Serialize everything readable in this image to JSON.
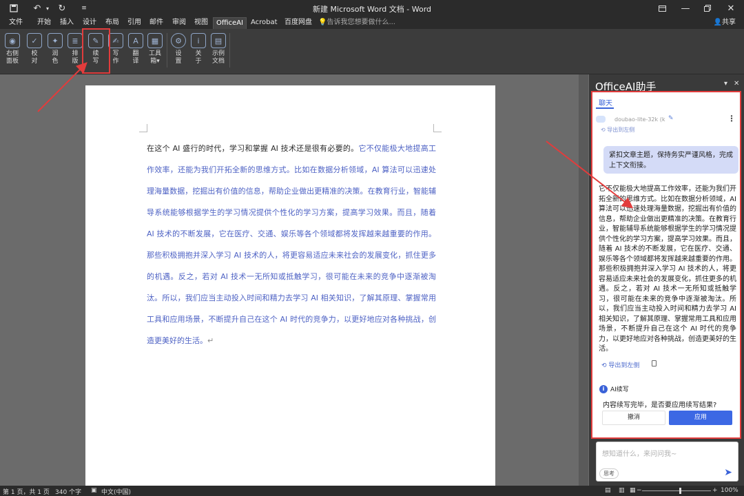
{
  "titlebar": {
    "title": "新建 Microsoft Word 文档 - Word",
    "quick_access": [
      "save-icon",
      "undo-icon",
      "redo-icon"
    ],
    "window_controls": [
      "ribbon-display-icon",
      "minimize-icon",
      "restore-icon",
      "close-icon"
    ]
  },
  "tabs": [
    "文件",
    "开始",
    "插入",
    "设计",
    "布局",
    "引用",
    "邮件",
    "审阅",
    "视图",
    "OfficeAI",
    "Acrobat",
    "百度网盘"
  ],
  "active_tab": "OfficeAI",
  "tell_me": "告诉我您想要做什么...",
  "share": "共享",
  "ribbon": {
    "buttons": [
      {
        "label": "右侧\n面板",
        "icon": "robot-icon"
      },
      {
        "label": "校\n对",
        "icon": "proofread-icon"
      },
      {
        "label": "润\n色",
        "icon": "polish-icon"
      },
      {
        "label": "排\n版",
        "icon": "format-icon"
      },
      {
        "label": "续\n写",
        "icon": "continue-write-icon"
      },
      {
        "label": "写\n作",
        "icon": "write-icon"
      },
      {
        "label": "翻\n译",
        "icon": "translate-icon"
      },
      {
        "label": "工具\n箱▾",
        "icon": "toolbox-icon"
      },
      {
        "label": "设\n置",
        "icon": "settings-icon"
      },
      {
        "label": "关\n于",
        "icon": "about-icon"
      },
      {
        "label": "示例\n文档",
        "icon": "sample-doc-icon"
      }
    ]
  },
  "document": {
    "text_plain": "在这个 AI 盛行的时代，学习和掌握 AI 技术还是很有必要的。",
    "text_ai": "它不仅能极大地提高工作效率，还能为我们开拓全新的思维方式。比如在数据分析领域，AI 算法可以迅速处理海量数据，挖掘出有价值的信息，帮助企业做出更精准的决策。在教育行业，智能辅导系统能够根据学生的学习情况提供个性化的学习方案，提高学习效果。而且，随着 AI 技术的不断发展，它在医疗、交通、娱乐等各个领域都将发挥越来越重要的作用。那些积极拥抱并深入学习 AI 技术的人，将更容易适应未来社会的发展变化，抓住更多的机遇。反之，若对 AI 技术一无所知或抵触学习，很可能在未来的竞争中逐渐被淘汰。所以，我们应当主动投入时间和精力去学习 AI 相关知识，了解其原理、掌握常用工具和应用场景，不断提升自己在这个 AI 时代的竞争力，以更好地应对各种挑战，创造更美好的生活。"
  },
  "assistant": {
    "title": "OfficeAI助手",
    "tab": "聊天",
    "model": "doubao-lite-32k (k",
    "top_link": "导出到左侧",
    "user_message": "紧扣文章主题，保持务实严谨风格，完成上下文衔接。",
    "ai_reply": "它不仅能极大地提高工作效率，还能为我们开拓全新的思维方式。比如在数据分析领域，AI 算法可以迅速处理海量数据，挖掘出有价值的信息，帮助企业做出更精准的决策。在教育行业，智能辅导系统能够根据学生的学习情况提供个性化的学习方案，提高学习效果。而且，随着 AI 技术的不断发展，它在医疗、交通、娱乐等各个领域都将发挥越来越重要的作用。那些积极拥抱并深入学习 AI 技术的人，将更容易适应未来社会的发展变化，抓住更多的机遇。反之，若对 AI 技术一无所知或抵触学习，很可能在未来的竞争中逐渐被淘汰。所以，我们应当主动投入时间和精力去学习 AI 相关知识，了解其原理、掌握常用工具和应用场景，不断提升自己在这个 AI 时代的竞争力，以更好地应对各种挑战，创造更美好的生活。",
    "export_label": "导出到左侧",
    "notice_title": "AI续写",
    "notice_text": "内容续写完毕，是否要应用续写结果?",
    "cancel_label": "撤消",
    "apply_label": "应用",
    "input_placeholder": "想知道什么，来问问我~",
    "think_label": "思考"
  },
  "status": {
    "page": "第 1 页，共 1 页",
    "words": "340 个字",
    "lang": "中文(中国)",
    "zoom": "100%"
  },
  "colors": {
    "highlight_red": "#e23c3c",
    "ai_text": "#4e62c4",
    "accent_blue": "#3c68e4"
  }
}
